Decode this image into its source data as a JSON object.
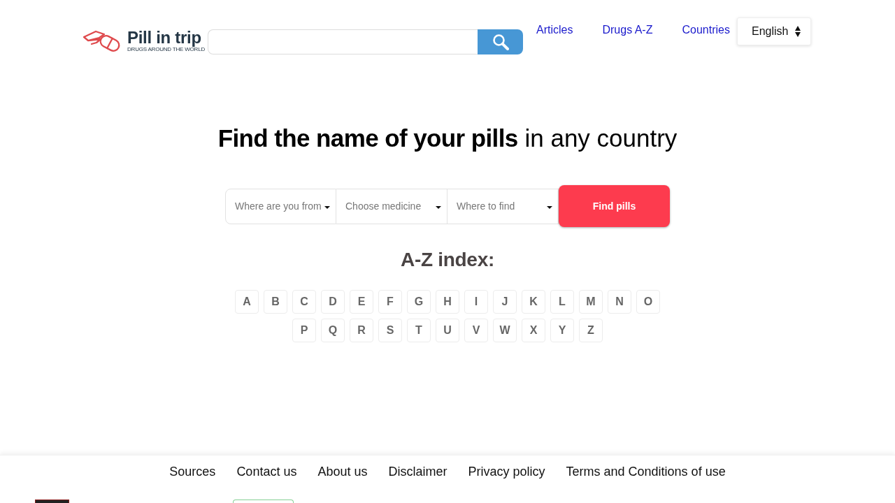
{
  "header": {
    "logo": {
      "name": "Pill in trip",
      "tagline": "DRUGS AROUND THE WORLD"
    },
    "nav": [
      "Articles",
      "Drugs A-Z",
      "Countries"
    ],
    "language": "English"
  },
  "hero": {
    "title": "**Find the name of your pills** in any country"
  },
  "finder": {
    "fields": [
      {
        "placeholder": "Where are you from"
      },
      {
        "placeholder": "Choose medicine"
      },
      {
        "placeholder": "Where to find"
      }
    ],
    "button": "Find pills"
  },
  "az_index": {
    "title": "A-Z index:",
    "letters": [
      "A",
      "B",
      "C",
      "D",
      "E",
      "F",
      "G",
      "H",
      "I",
      "J",
      "K",
      "L",
      "M",
      "N",
      "O",
      "P",
      "Q",
      "R",
      "S",
      "T",
      "U",
      "V",
      "W",
      "X",
      "Y",
      "Z"
    ]
  },
  "footer": {
    "links": [
      "Sources",
      "Contact us",
      "About us",
      "Disclaimer",
      "Privacy policy",
      "Terms and Conditions of use"
    ]
  }
}
